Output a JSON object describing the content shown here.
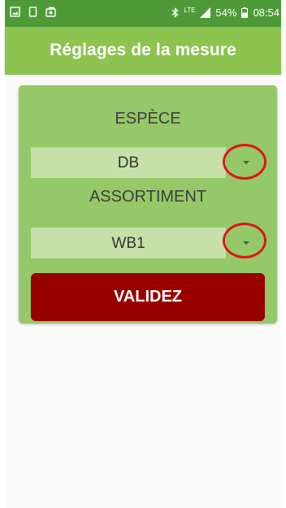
{
  "status_bar": {
    "left_icons": [
      "image-icon",
      "phone-icon",
      "photo-icon"
    ],
    "bluetooth_icon": "bluetooth-icon",
    "network_type": "LTE",
    "signal_icon": "signal-icon",
    "battery_percent": "54%",
    "battery_icon": "battery-icon",
    "time": "08:54",
    "colors": {
      "background": "#4e9a38",
      "text": "#ffffff"
    }
  },
  "app_bar": {
    "title": "Réglages de la mesure",
    "background": "#8dc34f"
  },
  "form": {
    "species": {
      "label": "ESPÈCE",
      "selected": "DB",
      "arrow_icon": "caret-down-icon"
    },
    "assortment": {
      "label": "ASSORTIMENT",
      "selected": "WB1",
      "arrow_icon": "caret-down-icon"
    },
    "submit_label": "VALIDEZ",
    "colors": {
      "card": "#95c868",
      "select": "#c5e0a9",
      "submit": "#980000",
      "annotation_circle": "#e0151b"
    }
  }
}
